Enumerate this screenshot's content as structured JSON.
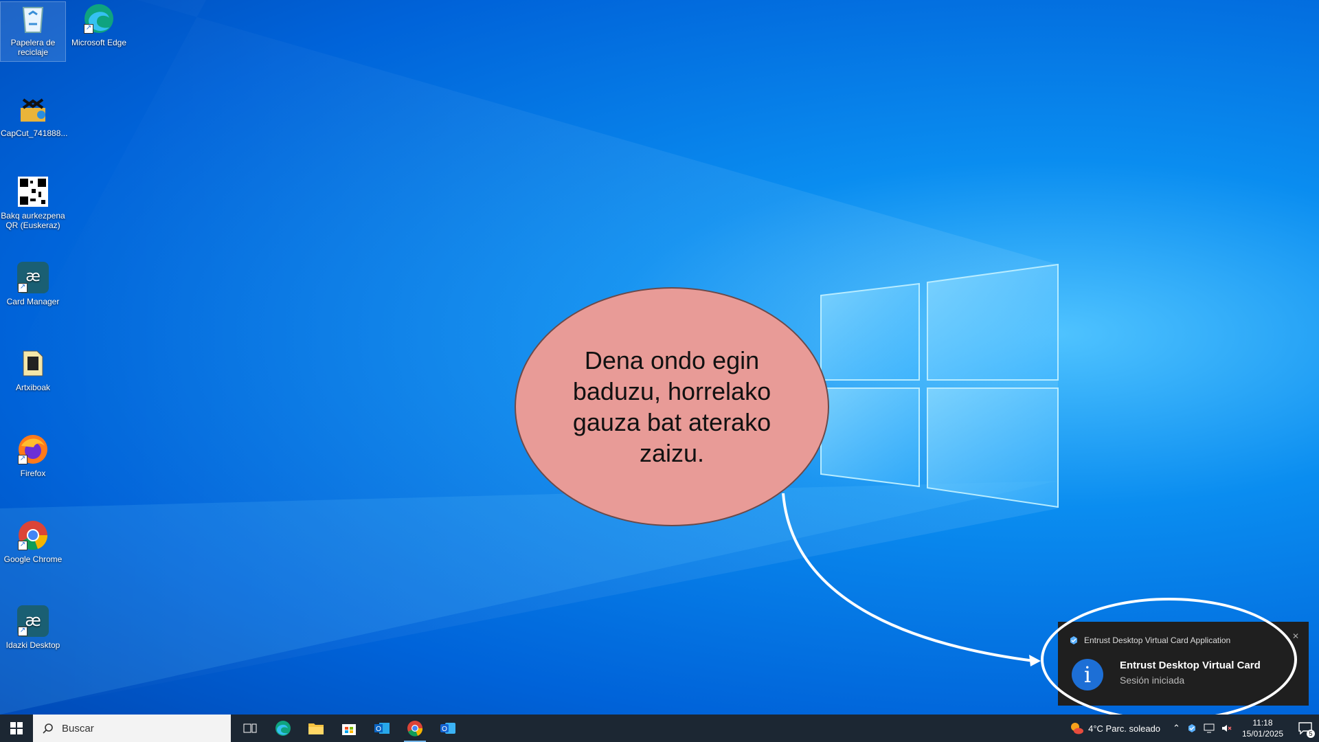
{
  "desktop": {
    "icons": [
      {
        "label": "Papelera de reciclaje",
        "icon": "recycle-bin-icon"
      },
      {
        "label": "Microsoft Edge",
        "icon": "edge-icon"
      },
      {
        "label": "CapCut_741888...",
        "icon": "capcut-icon"
      },
      {
        "label": "Bakq aurkezpena QR (Euskeraz)",
        "icon": "qr-code-icon"
      },
      {
        "label": "Card Manager",
        "icon": "izenpe-icon"
      },
      {
        "label": "Artxiboak",
        "icon": "folder-icon"
      },
      {
        "label": "Firefox",
        "icon": "firefox-icon"
      },
      {
        "label": "Google Chrome",
        "icon": "chrome-icon"
      },
      {
        "label": "Idazki Desktop",
        "icon": "izenpe-icon"
      }
    ]
  },
  "callout": {
    "text": "Dena ondo egin baduzu, horrelako gauza bat aterako zaizu."
  },
  "toast": {
    "app_name": "Entrust Desktop Virtual Card Application",
    "title": "Entrust Desktop Virtual Card",
    "message": "Sesión iniciada",
    "close": "✕"
  },
  "taskbar": {
    "search_placeholder": "Buscar",
    "weather": "4°C  Parc. soleado",
    "time": "11:18",
    "date": "15/01/2025",
    "notification_count": "5",
    "apps": [
      {
        "name": "task-view-icon"
      },
      {
        "name": "edge-icon"
      },
      {
        "name": "file-explorer-icon"
      },
      {
        "name": "store-icon"
      },
      {
        "name": "outlook-icon"
      },
      {
        "name": "chrome-icon",
        "active": true
      },
      {
        "name": "outlook-new-icon"
      }
    ]
  },
  "colors": {
    "accent": "#0078d4",
    "bubble": "#e89b97",
    "taskbar": "#1c2733"
  }
}
